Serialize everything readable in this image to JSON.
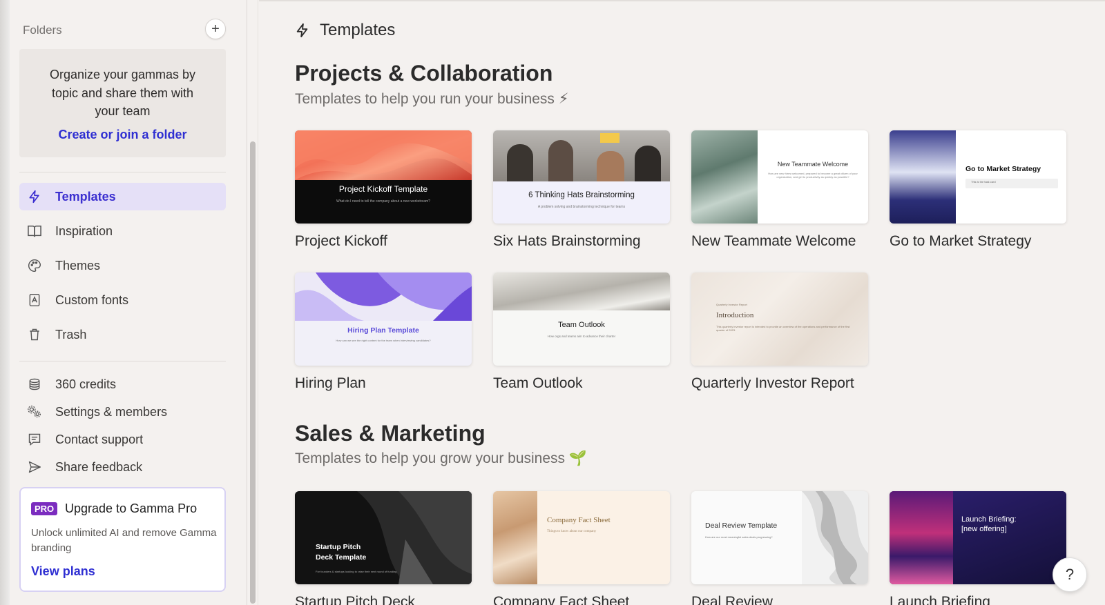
{
  "sidebar": {
    "folders_label": "Folders",
    "add_folder": "+",
    "folder_card": {
      "description": "Organize your gammas by topic and share them with your team",
      "link": "Create or join a folder"
    },
    "nav": [
      {
        "label": "Templates",
        "icon": "lightning-icon",
        "active": true
      },
      {
        "label": "Inspiration",
        "icon": "book-icon"
      },
      {
        "label": "Themes",
        "icon": "palette-icon"
      },
      {
        "label": "Custom fonts",
        "icon": "font-icon"
      },
      {
        "label": "Trash",
        "icon": "trash-icon"
      }
    ],
    "bottom": [
      {
        "label": "360 credits",
        "icon": "coins-icon"
      },
      {
        "label": "Settings & members",
        "icon": "gears-icon"
      },
      {
        "label": "Contact support",
        "icon": "chat-icon"
      },
      {
        "label": "Share feedback",
        "icon": "send-icon"
      }
    ],
    "pro": {
      "badge": "PRO",
      "title": "Upgrade to Gamma Pro",
      "description": "Unlock unlimited AI and remove Gamma branding",
      "link": "View plans"
    }
  },
  "main": {
    "page_title": "Templates",
    "sections": [
      {
        "title": "Projects & Collaboration",
        "subtitle": "Templates to help you run your business ⚡",
        "templates": [
          {
            "name": "Project Kickoff",
            "thumb_title": "Project Kickoff Template",
            "thumb_sub": "What do I need to tell the company about a new workstream?"
          },
          {
            "name": "Six Hats Brainstorming",
            "thumb_title": "6 Thinking Hats Brainstorming",
            "thumb_sub": "A problem solving and brainstorming technique for teams"
          },
          {
            "name": "New Teammate Welcome",
            "thumb_title": "New Teammate Welcome",
            "thumb_sub": "How are new hires welcomed, prepared to become a great citizen of your organization, and get to productivity as quickly as possible?"
          },
          {
            "name": "Go to Market Strategy",
            "thumb_title": "Go to Market Strategy",
            "thumb_sub": "This is the task card"
          },
          {
            "name": "Hiring Plan",
            "thumb_title": "Hiring Plan Template",
            "thumb_sub": "How can we see the right content for the team when interviewing candidates?"
          },
          {
            "name": "Team Outlook",
            "thumb_title": "Team Outlook",
            "thumb_sub": "How orgs and teams aim to advance their charter"
          },
          {
            "name": "Quarterly Investor Report",
            "thumb_title": "Introduction",
            "thumb_kicker": "Quarterly Investor Report",
            "thumb_sub": "This quarterly investor report is intended to provide an overview of the operations and performance of the first quarter of 2023."
          }
        ]
      },
      {
        "title": "Sales & Marketing",
        "subtitle": "Templates to help you grow your business 🌱",
        "templates": [
          {
            "name": "Startup Pitch Deck",
            "thumb_title": "Startup Pitch\nDeck Template",
            "thumb_sub": "For founders & startups looking to raise their next round of funding"
          },
          {
            "name": "Company Fact Sheet",
            "thumb_title": "Company Fact Sheet",
            "thumb_sub": "Things to know about our company"
          },
          {
            "name": "Deal Review",
            "thumb_title": "Deal Review Template",
            "thumb_sub": "How are our most meaningful sales deals progressing?"
          },
          {
            "name": "Launch Briefing",
            "thumb_title": "Launch Briefing:\n[new offering]",
            "thumb_sub": ""
          }
        ]
      }
    ]
  },
  "help_label": "?",
  "colors": {
    "accent": "#2f2fd2",
    "active_bg": "#e5e0f7",
    "pro_badge": "#7b2cbf"
  }
}
